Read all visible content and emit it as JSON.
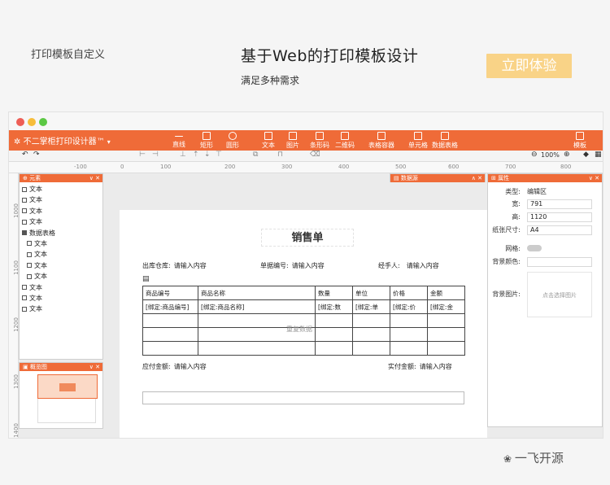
{
  "header": {
    "left_text": "打印模板自定义",
    "title": "基于Web的打印模板设计",
    "subtitle": "满足多种需求",
    "cta_label": "立即体验"
  },
  "app": {
    "title": "不二掌柜打印设计器™",
    "tools": [
      {
        "label": "直线",
        "icon": "line-icon"
      },
      {
        "label": "矩形",
        "icon": "rectangle-icon"
      },
      {
        "label": "圆形",
        "icon": "circle-icon"
      },
      {
        "label": "文本",
        "icon": "text-icon"
      },
      {
        "label": "图片",
        "icon": "image-icon"
      },
      {
        "label": "条形码",
        "icon": "barcode-icon"
      },
      {
        "label": "二维码",
        "icon": "qrcode-icon"
      },
      {
        "label": "表格容器",
        "icon": "table-container-icon"
      },
      {
        "label": "单元格",
        "icon": "cell-icon"
      },
      {
        "label": "数据表格",
        "icon": "data-table-icon"
      },
      {
        "label": "模板",
        "icon": "template-icon"
      }
    ],
    "zoom": "100%",
    "ruler_h": [
      "-100",
      "0",
      "100",
      "200",
      "300",
      "400",
      "500",
      "600",
      "700",
      "800"
    ],
    "ruler_v": [
      "1000",
      "1100",
      "1200",
      "1300",
      "1400"
    ]
  },
  "elements_panel": {
    "title": "元素",
    "items": [
      "文本",
      "文本",
      "文本",
      "文本",
      "数据表格",
      "文本",
      "文本",
      "文本",
      "文本",
      "文本",
      "文本",
      "文本"
    ]
  },
  "overview_panel": {
    "title": "概览图"
  },
  "datasource_panel": {
    "title": "数据源"
  },
  "document": {
    "title": "销售单",
    "warehouse_label": "出库仓库:",
    "warehouse_value": "请输入内容",
    "order_no_label": "单据编号:",
    "order_no_value": "请输入内容",
    "handler_label": "经手人:",
    "handler_value": "请输入内容",
    "columns": [
      "商品编号",
      "商品名称",
      "数量",
      "单位",
      "价格",
      "金额"
    ],
    "binding_row": [
      "[绑定:商品编号]",
      "[绑定:商品名称]",
      "[绑定:数",
      "[绑定:单",
      "[绑定:价",
      "[绑定:金"
    ],
    "watermark": "重复数据",
    "payable_label": "应付金额:",
    "payable_value": "请输入内容",
    "paid_label": "实付金额:",
    "paid_value": "请输入内容"
  },
  "properties": {
    "title": "属性",
    "type_label": "类型:",
    "type_value": "编辑区",
    "width_label": "宽:",
    "width_value": "791",
    "height_label": "高:",
    "height_value": "1120",
    "paper_label": "纸张尺寸:",
    "paper_value": "A4",
    "grid_label": "网格:",
    "bgcolor_label": "背景颜色:",
    "bgimage_label": "背景图片:",
    "bgimage_hint": "点击选择图片"
  },
  "watermark_logo": "一飞开源",
  "colors": {
    "accent": "#ef6b38",
    "cta": "#f9d387"
  }
}
